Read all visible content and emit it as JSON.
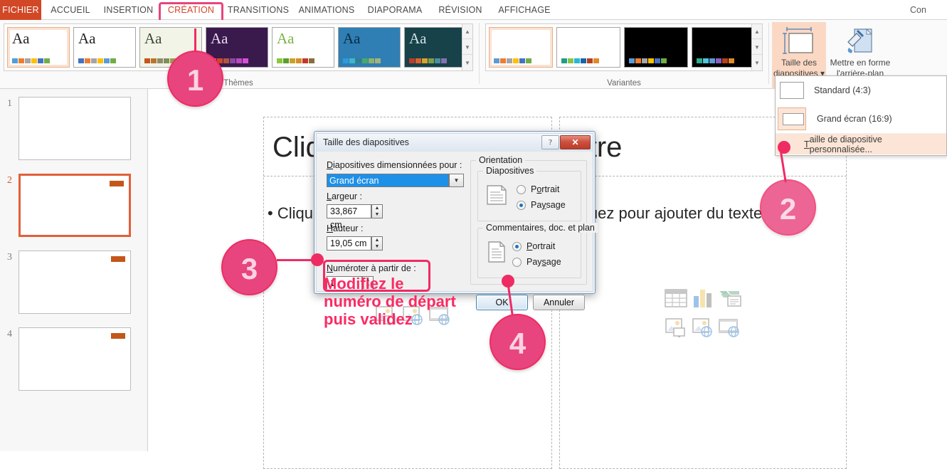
{
  "app": {
    "account_label": "Con"
  },
  "ribbon": {
    "tabs": [
      {
        "label": "FICHIER",
        "id": "fichier"
      },
      {
        "label": "ACCUEIL",
        "id": "accueil"
      },
      {
        "label": "INSERTION",
        "id": "insertion"
      },
      {
        "label": "CRÉATION",
        "id": "creation"
      },
      {
        "label": "TRANSITIONS",
        "id": "transitions"
      },
      {
        "label": "ANIMATIONS",
        "id": "animations"
      },
      {
        "label": "DIAPORAMA",
        "id": "diaporama"
      },
      {
        "label": "RÉVISION",
        "id": "revision"
      },
      {
        "label": "AFFICHAGE",
        "id": "affichage"
      }
    ],
    "active_tab": "CRÉATION",
    "groups": {
      "themes_label": "Thèmes",
      "variants_label": "Variantes"
    },
    "themes": [
      {
        "name": "theme-office",
        "aa": "Aa",
        "bg": "#ffffff",
        "aa_color": "#262626",
        "swatches": [
          "#4e9fd8",
          "#ed7d31",
          "#a5a5a5",
          "#ffc000",
          "#4472c4",
          "#70ad47"
        ]
      },
      {
        "name": "theme-facet",
        "aa": "Aa",
        "bg": "#ffffff",
        "aa_color": "#262626",
        "swatches": [
          "#4472c4",
          "#ed7d31",
          "#a5a5a5",
          "#ffc000",
          "#5b9bd5",
          "#70ad47"
        ]
      },
      {
        "name": "theme-organic",
        "aa": "Aa",
        "bg": "#f3f4e8",
        "aa_color": "#3a4a3a",
        "swatches": [
          "#c4561a",
          "#b9762e",
          "#8d8d6a",
          "#7f8f5a",
          "#96a14e",
          "#6b7b3c"
        ]
      },
      {
        "name": "theme-berlin",
        "aa": "Aa",
        "bg": "#3a1a4d",
        "aa_color": "#e8d8f0",
        "swatches": [
          "#e87d3e",
          "#d24726",
          "#b0563f",
          "#8a4a9e",
          "#b84ac0",
          "#d64fd6"
        ]
      },
      {
        "name": "theme-wisp",
        "aa": "Aa",
        "bg": "#ffffff",
        "aa_color": "#7cb342",
        "swatches": [
          "#8dc63f",
          "#5a9e2f",
          "#c9a227",
          "#d98c2b",
          "#c0392b",
          "#8a6d3b"
        ]
      },
      {
        "name": "theme-ion-boardroom",
        "aa": "Aa",
        "bg": "#2f7fb5",
        "aa_color": "#0b2a3f",
        "swatches": [
          "#2f9bd8",
          "#3fb6c9",
          "#2f7f8f",
          "#4aa86a",
          "#8fb36a",
          "#a8b07a"
        ]
      },
      {
        "name": "theme-celestial",
        "aa": "Aa",
        "bg": "#17424a",
        "aa_color": "#cfe3e5",
        "swatches": [
          "#c0392b",
          "#d9642b",
          "#d9a22b",
          "#7f9e4a",
          "#4a8f9e",
          "#8a6fae"
        ]
      }
    ],
    "variants": [
      {
        "name": "variant-1",
        "bg": "#ffffff",
        "selected": true,
        "swatches": [
          "#5b9bd5",
          "#ed7d31",
          "#a5a5a5",
          "#ffc000",
          "#4472c4",
          "#70ad47"
        ]
      },
      {
        "name": "variant-2",
        "bg": "#ffffff",
        "selected": false,
        "swatches": [
          "#1f9e85",
          "#8bc34a",
          "#29b6d6",
          "#1565a8",
          "#b5401f",
          "#e08a2b"
        ]
      },
      {
        "name": "variant-3",
        "bg": "#000000",
        "selected": false,
        "swatches": [
          "#5b9bd5",
          "#ed7d31",
          "#a5a5a5",
          "#ffc000",
          "#4472c4",
          "#70ad47"
        ]
      },
      {
        "name": "variant-4",
        "bg": "#000000",
        "selected": false,
        "swatches": [
          "#2fae8f",
          "#53c5d8",
          "#5b9bd5",
          "#8a5fbf",
          "#b5401f",
          "#e08a2b"
        ]
      }
    ],
    "slide_size_button": {
      "line1": "Taille des",
      "line2": "diapositives ▾"
    },
    "format_bg_button": {
      "line1": "Mettre en forme",
      "line2": "l'arrière-plan"
    }
  },
  "size_menu": {
    "items": [
      {
        "label": "Standard (4:3)",
        "name": "menu-item-standard",
        "active": false
      },
      {
        "label": "Grand écran (16:9)",
        "name": "menu-item-widescreen",
        "active": true
      }
    ],
    "custom_item": {
      "accel": "T",
      "rest": "aille de diapositive personnalisée..."
    }
  },
  "thumbnails": {
    "slides": [
      {
        "number": "1",
        "selected": false,
        "has_badge": false
      },
      {
        "number": "2",
        "selected": true,
        "has_badge": true
      },
      {
        "number": "3",
        "selected": false,
        "has_badge": true
      },
      {
        "number": "4",
        "selected": false,
        "has_badge": true
      }
    ]
  },
  "slide": {
    "title_placeholder": "Cliquez pour ajouter un titre",
    "body_left_placeholder": "• Cliquez pour ajouter du texte",
    "body_right_placeholder": "Cliquez pour ajouter du texte",
    "content_icons": [
      "table-icon",
      "chart-icon",
      "smartart-icon",
      "picture-icon",
      "online-picture-icon",
      "video-icon"
    ]
  },
  "dialog": {
    "title": "Taille des diapositives",
    "help_glyph": "?",
    "close_glyph": "✕",
    "sized_for_label": {
      "accel": "D",
      "rest": "iapositives dimensionnées pour :"
    },
    "sized_for_value": "Grand écran",
    "width_label": {
      "accel": "L",
      "rest": "argeur :"
    },
    "width_value": "33,867 cm",
    "height_label": {
      "accel": "H",
      "rest": "auteur :"
    },
    "height_value": "19,05 cm",
    "numbering_label": {
      "accel": "N",
      "rest": "uméroter à partir de :"
    },
    "numbering_value": "1",
    "orientation_legend": "Orientation",
    "slides_legend": "Diapositives",
    "notes_legend": "Commentaires, doc. et plan",
    "slides_portrait": {
      "pre": "P",
      "accel": "o",
      "post": "rtrait",
      "checked": false
    },
    "slides_landscape": {
      "pre": "Pa",
      "accel": "y",
      "post": "sage",
      "checked": true
    },
    "notes_portrait": {
      "pre": "",
      "accel": "P",
      "post": "ortrait",
      "checked": true
    },
    "notes_landscape": {
      "pre": "Pay",
      "accel": "s",
      "post": "age",
      "checked": false
    },
    "ok_label": "OK",
    "cancel_label": "Annuler"
  },
  "annotations": {
    "badges": [
      {
        "number": "1",
        "name": "annotation-badge-1"
      },
      {
        "number": "2",
        "name": "annotation-badge-2"
      },
      {
        "number": "3",
        "name": "annotation-badge-3"
      },
      {
        "number": "4",
        "name": "annotation-badge-4"
      }
    ],
    "instruction_line1": "Modifiez le",
    "instruction_line2": "numéro de départ",
    "instruction_line3": "puis validez",
    "accent_color": "#ef2b63"
  }
}
